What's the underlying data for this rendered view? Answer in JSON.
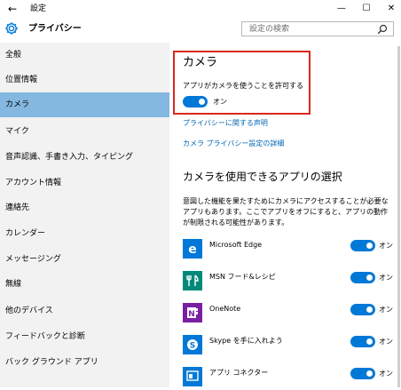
{
  "window": {
    "title": "設定",
    "back_glyph": "←",
    "minimize_glyph": "—",
    "maximize_glyph": "☐",
    "close_glyph": "✕"
  },
  "header": {
    "title": "プライバシー",
    "icon": "gear-icon",
    "search_placeholder": "設定の検索"
  },
  "sidebar": {
    "items": [
      {
        "label": "全般"
      },
      {
        "label": "位置情報"
      },
      {
        "label": "カメラ",
        "selected": true
      },
      {
        "label": "マイク"
      },
      {
        "label": "音声認識、手書き入力、タイピング"
      },
      {
        "label": "アカウント情報"
      },
      {
        "label": "連絡先"
      },
      {
        "label": "カレンダー"
      },
      {
        "label": "メッセージング"
      },
      {
        "label": "無線"
      },
      {
        "label": "他のデバイス"
      },
      {
        "label": "フィードバックと診断"
      },
      {
        "label": "バック グラウンド アプリ"
      }
    ]
  },
  "main": {
    "camera_heading": "カメラ",
    "allow_label": "アプリがカメラを使うことを許可する",
    "allow_toggle": {
      "state": "オン",
      "on": true
    },
    "privacy_link": "プライバシーに関する声明",
    "camera_privacy_link": "カメラ プライバシー設定の詳細",
    "apps_heading": "カメラを使用できるアプリの選択",
    "apps_description": "意図した機能を果たすためにカメラにアクセスすることが必要なアプリもあります。ここでアプリをオフにすると、アプリの動作が制限される可能性があります。",
    "apps": [
      {
        "name": "Microsoft Edge",
        "toggle": "オン",
        "icon": "edge-icon",
        "color": "#0078d7"
      },
      {
        "name": "MSN フード&レシピ",
        "toggle": "オン",
        "icon": "food-icon",
        "color": "#00897b"
      },
      {
        "name": "OneNote",
        "toggle": "オン",
        "icon": "onenote-icon",
        "color": "#7b1fa2"
      },
      {
        "name": "Skype を手に入れよう",
        "toggle": "オン",
        "icon": "skype-icon",
        "color": "#0078d7"
      },
      {
        "name": "アプリ コネクター",
        "toggle": "オン",
        "icon": "app-connector-icon",
        "color": "#0078d7"
      }
    ]
  },
  "colors": {
    "accent": "#0078d7",
    "selected_bg": "#84b8e0",
    "sidebar_bg": "#f2f2f2",
    "highlight_box": "#d9281e",
    "link": "#0066b4"
  }
}
